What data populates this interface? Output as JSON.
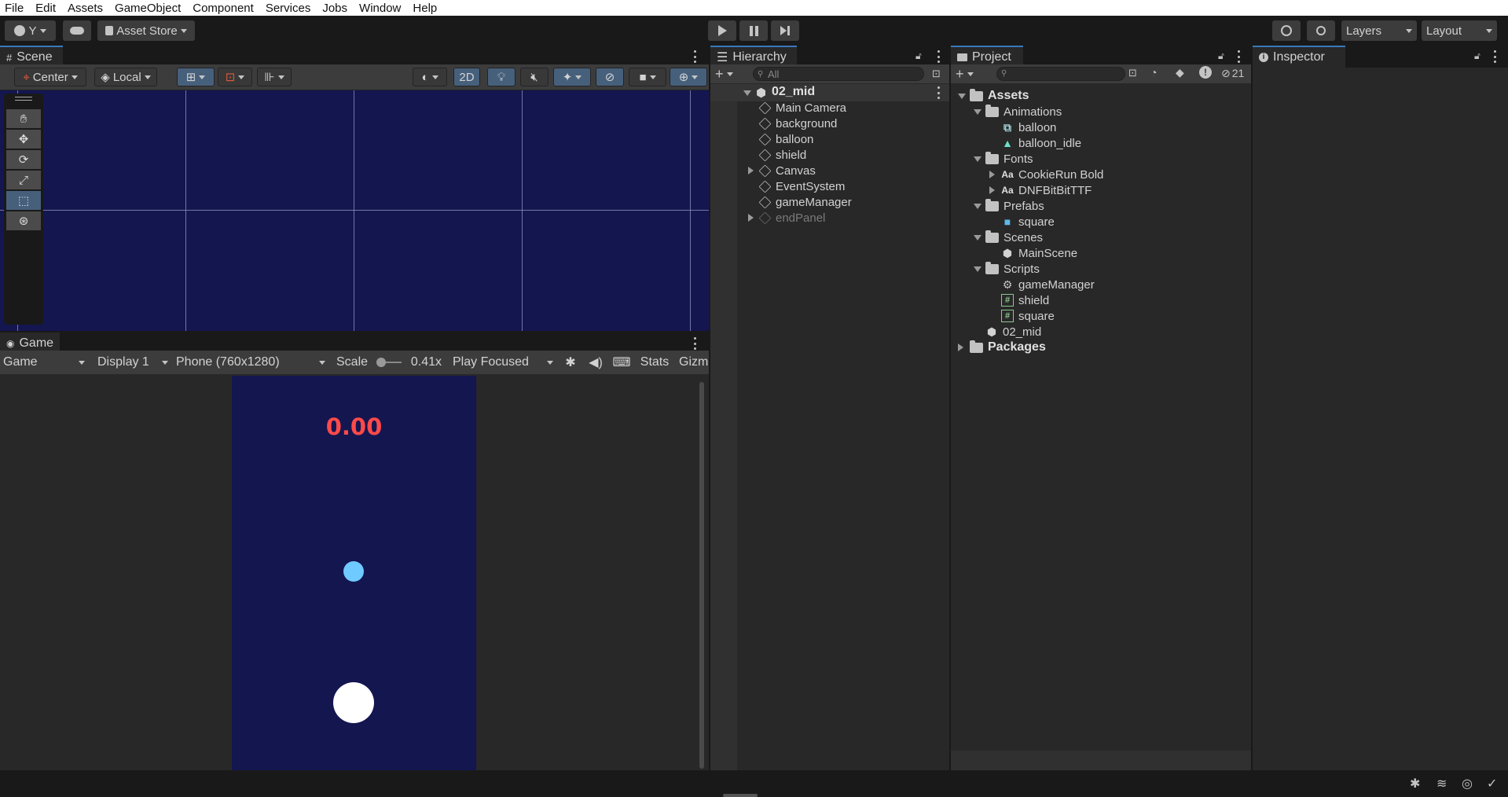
{
  "menubar": {
    "items": [
      "File",
      "Edit",
      "Assets",
      "GameObject",
      "Component",
      "Services",
      "Jobs",
      "Window",
      "Help"
    ]
  },
  "toolbar": {
    "account_label": "Y",
    "asset_store_label": "Asset Store",
    "layers_label": "Layers",
    "layout_label": "Layout"
  },
  "scene": {
    "tab_label": "Scene",
    "pivot_label": "Center",
    "space_label": "Local",
    "mode_2d_label": "2D",
    "background_color": "#141650"
  },
  "game": {
    "tab_label": "Game",
    "view_label": "Game",
    "display_label": "Display 1",
    "resolution_label": "Phone (760x1280)",
    "scale_label": "Scale",
    "scale_value": "0.41x",
    "play_mode_label": "Play Focused",
    "stats_label": "Stats",
    "gizmos_label": "Gizmos",
    "score_text": "0.00",
    "score_color": "#ff4a4a",
    "background_color": "#141650",
    "shield_color": "#6fcbff",
    "balloon_color": "#ffffff"
  },
  "hierarchy": {
    "tab_label": "Hierarchy",
    "search_placeholder": "All",
    "scene_name": "02_mid",
    "items": [
      {
        "label": "Main Camera",
        "expandable": false,
        "inactive": false
      },
      {
        "label": "background",
        "expandable": false,
        "inactive": false
      },
      {
        "label": "balloon",
        "expandable": false,
        "inactive": false
      },
      {
        "label": "shield",
        "expandable": false,
        "inactive": false
      },
      {
        "label": "Canvas",
        "expandable": true,
        "inactive": false
      },
      {
        "label": "EventSystem",
        "expandable": false,
        "inactive": false
      },
      {
        "label": "gameManager",
        "expandable": false,
        "inactive": false
      },
      {
        "label": "endPanel",
        "expandable": true,
        "inactive": true
      }
    ]
  },
  "project": {
    "tab_label": "Project",
    "hidden_count": "21",
    "tree": [
      {
        "label": "Assets",
        "level": 0,
        "icon": "folder-icon",
        "bold": true,
        "expanded": true
      },
      {
        "label": "Animations",
        "level": 1,
        "icon": "folder-icon",
        "expanded": true
      },
      {
        "label": "balloon",
        "level": 2,
        "icon": "animator-icon"
      },
      {
        "label": "balloon_idle",
        "level": 2,
        "icon": "animation-clip-icon"
      },
      {
        "label": "Fonts",
        "level": 1,
        "icon": "folder-icon",
        "expanded": true
      },
      {
        "label": "CookieRun Bold",
        "level": 2,
        "icon": "font-icon",
        "expandable": true
      },
      {
        "label": "DNFBitBitTTF",
        "level": 2,
        "icon": "font-icon",
        "expandable": true
      },
      {
        "label": "Prefabs",
        "level": 1,
        "icon": "folder-icon",
        "expanded": true
      },
      {
        "label": "square",
        "level": 2,
        "icon": "prefab-icon"
      },
      {
        "label": "Scenes",
        "level": 1,
        "icon": "folder-icon",
        "expanded": true
      },
      {
        "label": "MainScene",
        "level": 2,
        "icon": "scene-icon"
      },
      {
        "label": "Scripts",
        "level": 1,
        "icon": "folder-icon",
        "expanded": true
      },
      {
        "label": "gameManager",
        "level": 2,
        "icon": "gear-icon"
      },
      {
        "label": "shield",
        "level": 2,
        "icon": "script-icon"
      },
      {
        "label": "square",
        "level": 2,
        "icon": "script-icon"
      },
      {
        "label": "02_mid",
        "level": 1,
        "icon": "scene-icon"
      },
      {
        "label": "Packages",
        "level": 0,
        "icon": "folder-icon",
        "bold": true,
        "expanded": false
      }
    ]
  },
  "inspector": {
    "tab_label": "Inspector"
  }
}
